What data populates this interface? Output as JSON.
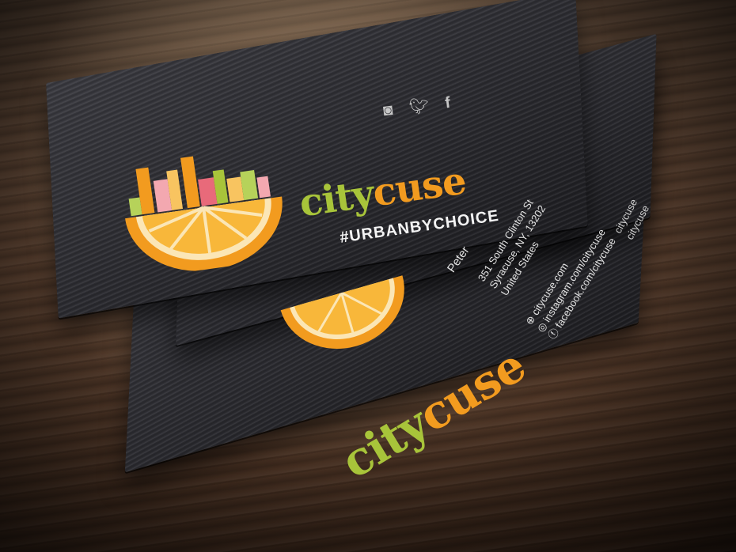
{
  "brand": {
    "name_part1": "city",
    "name_part2": "cuse",
    "hashtag": "#URBANBYCHOICE"
  },
  "contact": {
    "name": "Peter",
    "street": "351 South Clinton St",
    "city_line": "Syracuse, NY, 13202",
    "country": "United States"
  },
  "links": {
    "website": "citycuse.com",
    "instagram": "instagram.com/citycuse",
    "facebook": "facebook.com/citycuse"
  },
  "icons": {
    "instagram": "instagram-icon",
    "twitter": "twitter-icon",
    "facebook": "facebook-icon",
    "globe": "globe-icon"
  },
  "colors": {
    "green": "#a8c43a",
    "orange": "#f29b1f",
    "card": "#2b2b30"
  }
}
